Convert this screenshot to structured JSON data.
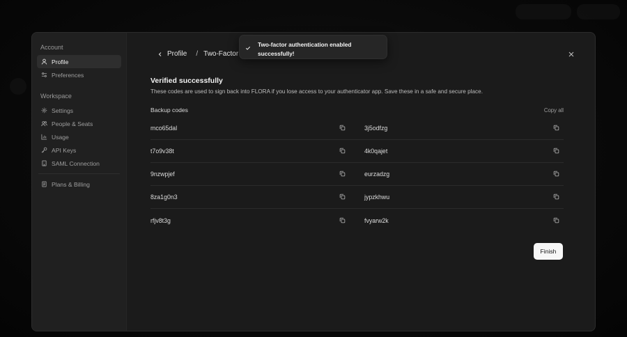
{
  "sidebar": {
    "account_heading": "Account",
    "account_items": [
      {
        "label": "Profile",
        "icon": "user-icon",
        "active": true
      },
      {
        "label": "Preferences",
        "icon": "sliders-icon",
        "active": false
      }
    ],
    "workspace_heading": "Workspace",
    "workspace_items": [
      {
        "label": "Settings",
        "icon": "gear-icon"
      },
      {
        "label": "People & Seats",
        "icon": "people-icon"
      },
      {
        "label": "Usage",
        "icon": "chart-icon"
      },
      {
        "label": "API Keys",
        "icon": "key-icon"
      },
      {
        "label": "SAML Connection",
        "icon": "building-icon"
      }
    ],
    "billing_items": [
      {
        "label": "Plans & Billing",
        "icon": "receipt-icon"
      }
    ]
  },
  "breadcrumb": {
    "back_label": "Profile",
    "separator": "/",
    "current": "Two-Factor A"
  },
  "toast": {
    "message": "Two-factor authentication enabled successfully!",
    "icon": "check-icon"
  },
  "main": {
    "title": "Verified successfully",
    "description": "These codes are used to sign back into FLORA if you lose access to your authenticator app. Save these in a safe and secure place.",
    "codes_label": "Backup codes",
    "copy_all_label": "Copy all",
    "codes": [
      [
        "mco65dal",
        "3j5odfzg"
      ],
      [
        "t7o9v38t",
        "4k0qajet"
      ],
      [
        "9nzwpjef",
        "eurzadzg"
      ],
      [
        "8za1g0n3",
        "jypzkhwu"
      ],
      [
        "rfjv8t3g",
        "fvyarw2k"
      ]
    ],
    "finish_label": "Finish"
  }
}
